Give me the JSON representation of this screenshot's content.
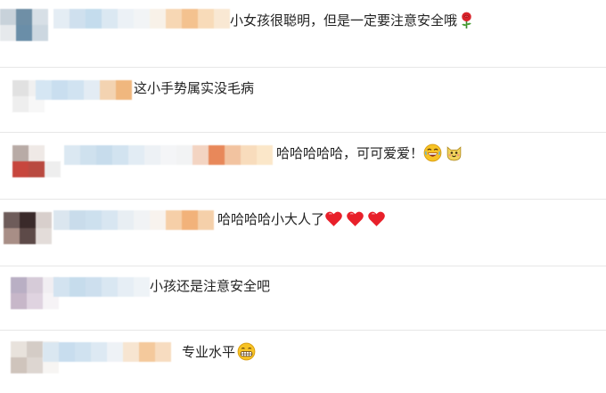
{
  "comments": [
    {
      "text": "小女孩很聪明，但是一定要注意安全哦",
      "emojis": [
        "rose-emoji"
      ],
      "avatar_colors": [
        "#c8d2da",
        "#6f8fa6",
        "#d7dfe6",
        "#e6e9ec",
        "#6a8ea8",
        "#ccd7e0"
      ],
      "name_colors": [
        "#e4edf4",
        "#cfe0ee",
        "#c4dced",
        "#dbe8f2",
        "#ecf1f6",
        "#f2f4f6",
        "#f8f1e8",
        "#f7d7b4",
        "#f4c28f",
        "#f8dbb9",
        "#f9e8d3"
      ]
    },
    {
      "text": "这小手势属实没毛病",
      "emojis": [],
      "avatar_colors": [
        "#e1e1e1",
        "#f0f0f0",
        "#ffffff",
        "#eeeeee",
        "#f7f7f7",
        "#ffffff"
      ],
      "name_colors": [
        "#d5e6f3",
        "#c9deef",
        "#d1e3f1",
        "#e3ecf4",
        "#f3d3b1",
        "#f0b77e"
      ]
    },
    {
      "text": "哈哈哈哈哈，可可爱爱！",
      "emojis": [
        "laughing-emoji",
        "cat-emoji"
      ],
      "avatar_colors": [
        "#b8aba6",
        "#efe9e6",
        "#ffffff",
        "#c7463d",
        "#b94a40",
        "#eeeeee"
      ],
      "name_colors": [
        "#dbe8f2",
        "#cfe1ee",
        "#c7dcec",
        "#d2e3f0",
        "#e2ecf4",
        "#edf1f5",
        "#f4f5f7",
        "#f2f3f4",
        "#f3d4c2",
        "#e8885a",
        "#f2c3a0",
        "#f8dcbc",
        "#fbe7c9"
      ]
    },
    {
      "text": "哈哈哈哈小大人了",
      "emojis": [
        "heart-emoji",
        "heart-emoji",
        "heart-emoji"
      ],
      "avatar_colors": [
        "#6e5c5a",
        "#3a2a2a",
        "#d8cfcc",
        "#a88e86",
        "#5d4a48",
        "#e3dcd9"
      ],
      "name_colors": [
        "#dbe6ef",
        "#c9dceb",
        "#cde0ee",
        "#d8e6f1",
        "#e8eef3",
        "#f1f3f5",
        "#f8f3ee",
        "#f6cfa8",
        "#f2b27a",
        "#f5d0aa"
      ]
    },
    {
      "text": "小孩还是注意安全吧",
      "emojis": [],
      "avatar_colors": [
        "#b9afc4",
        "#d6cbd8",
        "#f1eef2",
        "#c7b7c9",
        "#dfd3e0",
        "#f6f3f6"
      ],
      "name_colors": [
        "#d3e3f0",
        "#c6dcec",
        "#cddfee",
        "#d9e7f2",
        "#e6eef5",
        "#eef3f7"
      ]
    },
    {
      "text": "专业水平",
      "emojis": [
        "grin-emoji"
      ],
      "avatar_colors": [
        "#e8e2dc",
        "#d4ccc6",
        "#f3f0ee",
        "#cfc4bc",
        "#ddd6d1",
        "#f7f5f3"
      ],
      "name_colors": [
        "#dae7f1",
        "#c8ddee",
        "#d0e2f0",
        "#dde9f3",
        "#eef2f6",
        "#f7e5d1",
        "#f4c99c",
        "#f7dcc0"
      ]
    }
  ]
}
